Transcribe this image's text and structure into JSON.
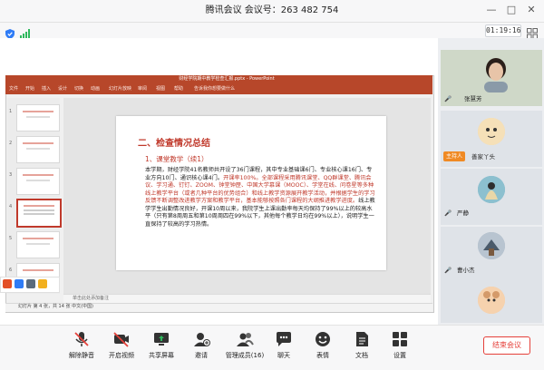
{
  "window": {
    "title": "腾讯会议  会议号：263 482 754",
    "minimize": "—",
    "maximize": "□",
    "close": "✕"
  },
  "info": {
    "timer": "01:19:16"
  },
  "ppt": {
    "title": "财经学院期中教学检查汇报.pptx - PowerPoint",
    "ribbon_tabs": [
      "文件",
      "开始",
      "插入",
      "设计",
      "切换",
      "动画",
      "幻灯片放映",
      "审阅",
      "视图",
      "帮助",
      "告诉我你想要做什么"
    ],
    "thumb_numbers": [
      "1",
      "2",
      "3",
      "4",
      "5",
      "6"
    ],
    "notes": "单击此处添加备注",
    "status": "幻灯片 第 4 张，共 14 张    中文(中国)"
  },
  "slide": {
    "heading": "二、检查情况总结",
    "subheading": "1、课堂教学（续1）",
    "body_1": "本学期，财经学院41名教师共开设了36门课程，其中专业基础课6门、专业核心课16门、专业方向10门、通识核心课4门。",
    "body_red_1": "开课率100%。全部课程采用腾讯课堂、QQ群课堂、腾讯会议、学习通、钉钉、ZOOM、钟堂钟歷、中国大学慕课（MOOC）、学堂在线、问卷星等多种线上教学平台（或者几种平台的优势组合）和线上教学资源展开教学活动，并根据学生的学习反馈不断调整改进教学方案和教学平台，基本能够按照各门课程的大纲推进教学进度。",
    "body_2": "线上教学学生出勤情况良好，开课10周以来，我院学生上课出勤率每天均保持了99%以上的较高水平（只有第8周周五和第10周周四在99%以下，其他每个教学日均在99%以上），说明学生一直保持了较高的学习热情。"
  },
  "participants": [
    {
      "name": "张慧芳",
      "role": ""
    },
    {
      "name": "善家丫头",
      "role": "主持人"
    },
    {
      "name": "严静",
      "role": ""
    },
    {
      "name": "曹小杰",
      "role": ""
    },
    {
      "name": "",
      "role": ""
    }
  ],
  "toolbar": {
    "items": [
      {
        "label": "解除静音",
        "icon": "mic-muted-icon"
      },
      {
        "label": "开启视频",
        "icon": "camera-off-icon"
      },
      {
        "label": "共享屏幕",
        "icon": "share-screen-icon"
      },
      {
        "label": "邀请",
        "icon": "invite-icon"
      },
      {
        "label": "管理成员(16)",
        "icon": "members-icon"
      },
      {
        "label": "聊天",
        "icon": "chat-icon"
      },
      {
        "label": "表情",
        "icon": "emoji-icon"
      },
      {
        "label": "文档",
        "icon": "document-icon"
      },
      {
        "label": "设置",
        "icon": "settings-icon"
      }
    ],
    "end_meeting": "结束会议"
  },
  "colors": {
    "ppt_red": "#b7472a",
    "slide_red": "#c0392b",
    "end_red": "#e5403a",
    "host_orange": "#f08a24"
  }
}
